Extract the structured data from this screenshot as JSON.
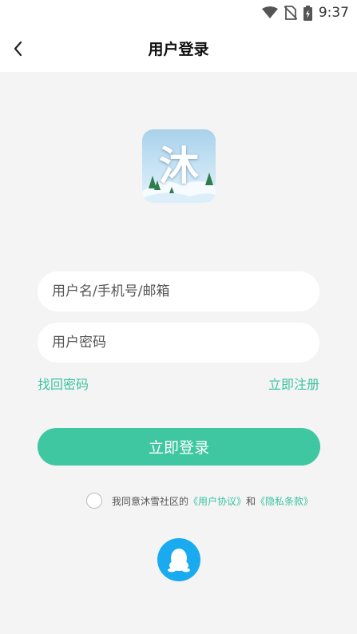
{
  "status_bar": {
    "time": "9:37",
    "icons": [
      "wifi-icon",
      "no-sim-icon",
      "battery-charging-icon"
    ]
  },
  "header": {
    "title": "用户登录",
    "back_icon": "chevron-left-icon"
  },
  "logo": {
    "char": "沐"
  },
  "form": {
    "username_placeholder": "用户名/手机号/邮箱",
    "password_placeholder": "用户密码",
    "forgot_label": "找回密码",
    "register_label": "立即注册",
    "login_label": "立即登录"
  },
  "agreement": {
    "prefix": "我同意沐雪社区的",
    "user_agreement": "《用户协议》",
    "and": "和",
    "privacy_policy": "《隐私条款》"
  },
  "social": {
    "qq_icon": "qq-penguin-icon"
  },
  "colors": {
    "accent": "#3ec7a0",
    "link": "#3cc39f",
    "qq": "#19aaf0",
    "background": "#f4f4f4"
  }
}
